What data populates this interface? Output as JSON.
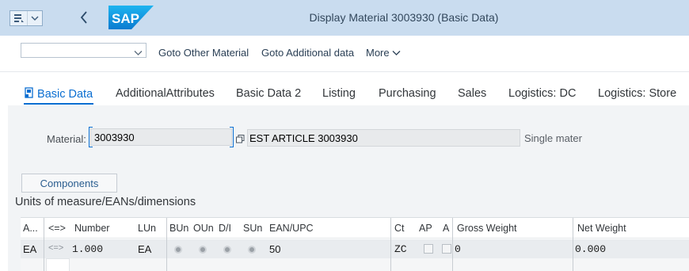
{
  "shell": {
    "title": "Display Material 3003930 (Basic Data)",
    "logo_text": "SAP"
  },
  "toolbar": {
    "select_value": "",
    "goto_other": "Goto Other Material",
    "goto_additional": "Goto Additional data",
    "more": "More"
  },
  "tabs": [
    {
      "label": "Basic Data",
      "active": true
    },
    {
      "label": "AdditionalAttributes"
    },
    {
      "label": "Basic Data 2"
    },
    {
      "label": "Listing"
    },
    {
      "label": "Purchasing"
    },
    {
      "label": "Sales"
    },
    {
      "label": "Logistics: DC"
    },
    {
      "label": "Logistics: Store"
    }
  ],
  "material": {
    "label": "Material:",
    "value": "3003930",
    "description": "EST ARTICLE 3003930",
    "type_text": "Single mater"
  },
  "components_button": "Components",
  "section_title": "Units of measure/EANs/dimensions",
  "table": {
    "headers": [
      "A...",
      "<=>",
      "Number",
      "LUn",
      "BUn",
      "OUn",
      "D/I",
      "SUn",
      "EAN/UPC",
      "Ct",
      "AP",
      "A",
      "Gross Weight",
      "Net Weight"
    ],
    "rows": [
      {
        "a": "EA",
        "arrow": "<=>",
        "number": "1.000",
        "lun": "EA",
        "ean": "50",
        "ct": "ZC",
        "gross": "0",
        "net": "0.000"
      }
    ]
  },
  "colors": {
    "shell_bg": "#c9dcef",
    "accent": "#0a6ed1",
    "panel_bg": "#f2f4f6"
  }
}
